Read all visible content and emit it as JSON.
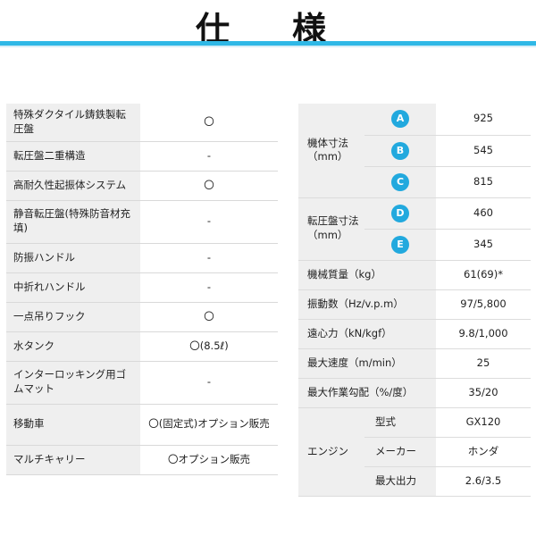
{
  "title": "仕　様",
  "left_rows": [
    {
      "label": "特殊ダクタイル鋳鉄製転圧盤",
      "value": "〇"
    },
    {
      "label": "転圧盤二重構造",
      "value": "-"
    },
    {
      "label": "高耐久性起振体システム",
      "value": "〇"
    },
    {
      "label": "静音転圧盤(特殊防音材充填)",
      "value": "-"
    },
    {
      "label": "防振ハンドル",
      "value": "-"
    },
    {
      "label": "中折れハンドル",
      "value": "-"
    },
    {
      "label": "一点吊りフック",
      "value": "〇"
    },
    {
      "label": "水タンク",
      "value": "〇(8.5ℓ)"
    },
    {
      "label": "インターロッキング用ゴムマット",
      "value": "-"
    },
    {
      "label": "移動車",
      "value": "〇(固定式)オプション販売"
    },
    {
      "label": "マルチキャリー",
      "value": "〇オプション販売"
    }
  ],
  "right": {
    "body_dims": {
      "label": "機体寸法\n（mm）",
      "rows": [
        {
          "badge": "A",
          "value": "925"
        },
        {
          "badge": "B",
          "value": "545"
        },
        {
          "badge": "C",
          "value": "815"
        }
      ]
    },
    "plate_dims": {
      "label": "転圧盤寸法\n（mm）",
      "rows": [
        {
          "badge": "D",
          "value": "460"
        },
        {
          "badge": "E",
          "value": "345"
        }
      ]
    },
    "specs": [
      {
        "label": "機械質量（kg）",
        "value": "61(69)*"
      },
      {
        "label": "振動数（Hz/v.p.m）",
        "value": "97/5,800"
      },
      {
        "label": "遠心力（kN/kgf）",
        "value": "9.8/1,000"
      },
      {
        "label": "最大速度（m/min）",
        "value": "25"
      },
      {
        "label": "最大作業勾配（%/度）",
        "value": "35/20"
      }
    ],
    "engine": {
      "label": "エンジン",
      "rows": [
        {
          "label": "型式",
          "value": "GX120"
        },
        {
          "label": "メーカー",
          "value": "ホンダ"
        },
        {
          "label": "最大出力",
          "value": "2.6/3.5"
        }
      ]
    }
  }
}
